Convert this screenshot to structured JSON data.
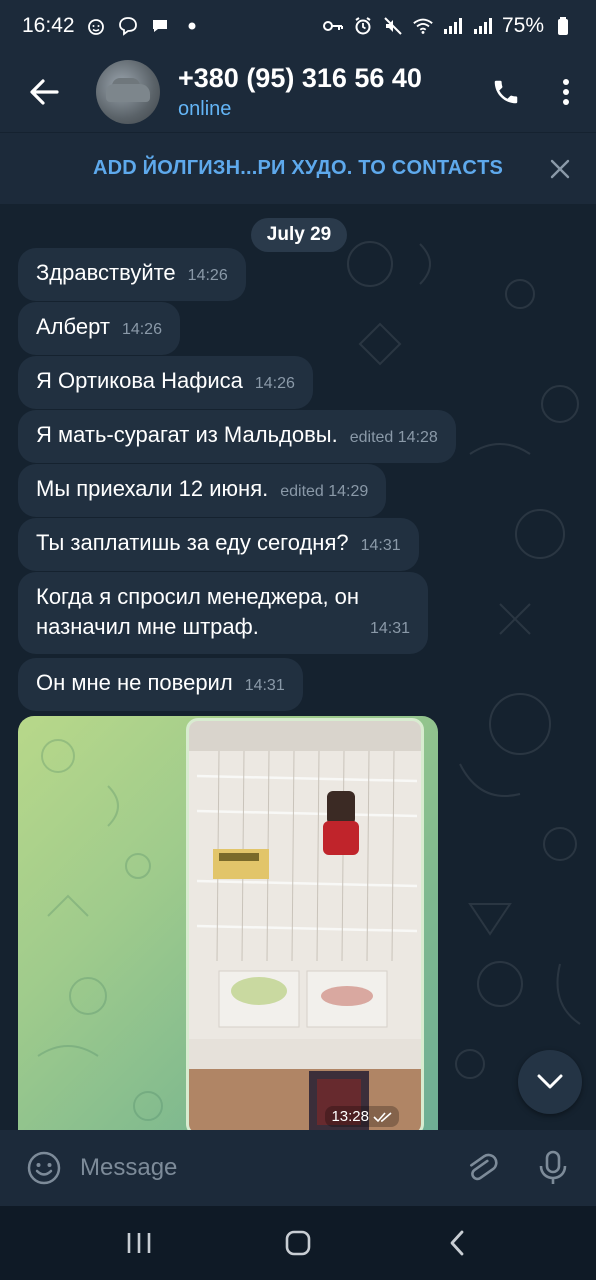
{
  "status_bar": {
    "time": "16:42",
    "left_icons": [
      "emoji-notification-icon",
      "viber-icon",
      "chat-bubble-icon",
      "dot-icon"
    ],
    "right_icons": [
      "key-icon",
      "alarm-icon",
      "mute-icon",
      "wifi-icon",
      "signal-icon",
      "signal-icon"
    ],
    "battery": "75%"
  },
  "header": {
    "contact_name": "+380 (95) 316 56 40",
    "contact_status": "online"
  },
  "add_banner": {
    "text": "ADD ЙОЛГИЗН...РИ ХУДО. TO CONTACTS"
  },
  "chat": {
    "date": "July 29",
    "messages": [
      {
        "text": "Здравствуйте",
        "time": "14:26"
      },
      {
        "text": "Алберт",
        "time": "14:26"
      },
      {
        "text": "Я Ортикова Нафиса",
        "time": "14:26"
      },
      {
        "text": "Я мать-сурагат из Мальдовы.",
        "time": "edited 14:28"
      },
      {
        "text": "Мы приехали 12 июня.",
        "time": "edited 14:29"
      },
      {
        "text": "Ты заплатишь за еду сегодня?",
        "time": "14:31"
      },
      {
        "text": "Когда я спросил менеджера, он\nназначил мне штраф.",
        "time": "14:31"
      },
      {
        "text": "Он мне не поверил",
        "time": "14:31"
      }
    ],
    "photo": {
      "time": "13:28"
    }
  },
  "input": {
    "placeholder": "Message"
  },
  "colors": {
    "accent": "#64b5f6",
    "bubble": "#213040",
    "header_bg": "#1c2a3a"
  }
}
